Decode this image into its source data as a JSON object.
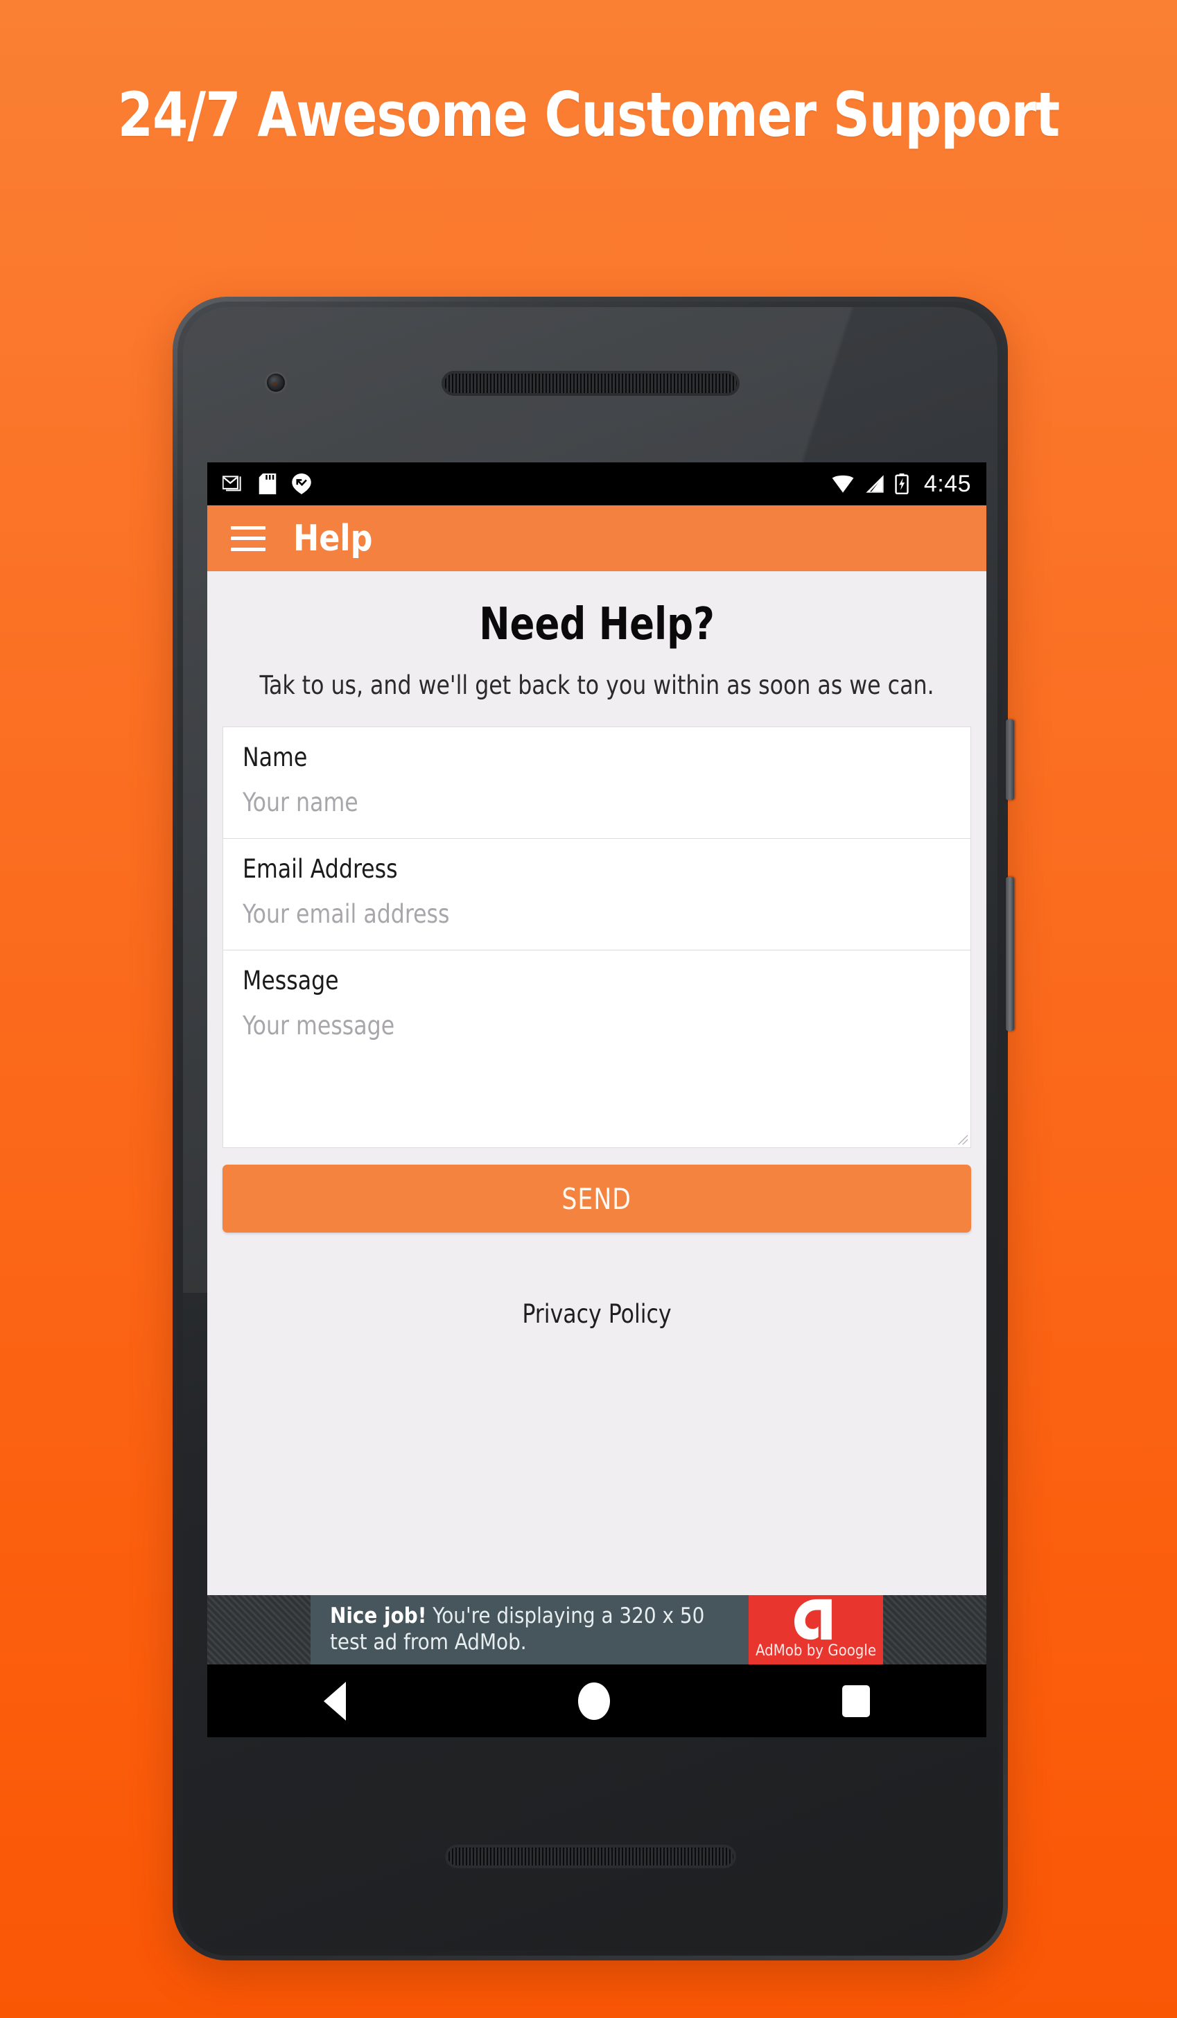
{
  "poster": {
    "headline": "24/7 Awesome Customer Support",
    "background_top_color": "#fa8034",
    "background_bottom_color": "#fa5705"
  },
  "statusbar": {
    "icons": [
      "gmail-icon",
      "sd-card-icon",
      "message-pin-icon"
    ],
    "wifi": "wifi-icon",
    "signal": "cell-signal-icon",
    "battery": "battery-charging-icon",
    "time": "4:45"
  },
  "appbar": {
    "menu_icon": "hamburger-menu-icon",
    "title": "Help",
    "color": "#f4813f"
  },
  "main": {
    "heading": "Need Help?",
    "subtitle": "Tak to us, and we'll get back to you within as soon as we can.",
    "fields": [
      {
        "label": "Name",
        "value": "",
        "placeholder": "Your name"
      },
      {
        "label": "Email Address",
        "value": "",
        "placeholder": "Your email address"
      },
      {
        "label": "Message",
        "value": "",
        "placeholder": "Your message"
      }
    ],
    "send_label": "SEND",
    "privacy_label": "Privacy Policy"
  },
  "ad": {
    "bold_text": "Nice job!",
    "text": " You're displaying a 320 x 50 test ad from AdMob.",
    "brand": "AdMob by Google",
    "logo_color": "#e8352e",
    "bg_color": "#46565c"
  },
  "navbar": {
    "back": "back-triangle-icon",
    "home": "home-circle-icon",
    "recents": "recents-square-icon"
  }
}
